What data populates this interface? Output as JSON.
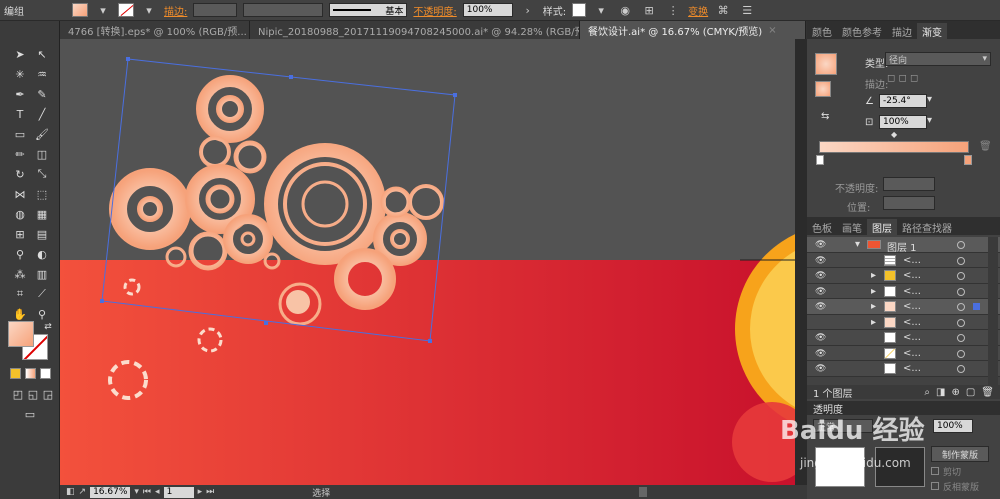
{
  "menu": {
    "label": "编组"
  },
  "control_bar": {
    "stroke_label": "描边:",
    "stroke_preset": "基本",
    "opacity_label": "不透明度:",
    "opacity_value": "100%",
    "style_label": "样式:",
    "transform_label": "变换",
    "fill_color": "#f9b295",
    "accent_color": "#f08c2a"
  },
  "tabs": [
    {
      "label": "4766 [转换].eps* @ 100% (RGB/预...",
      "close": "×"
    },
    {
      "label": "Nipic_20180988_20171119094708245000.ai* @ 94.28% (RGB/预...",
      "close": "×"
    },
    {
      "label": "餐饮设计.ai* @ 16.67% (CMYK/预览)",
      "close": "×"
    }
  ],
  "gradient_panel": {
    "tabs": [
      "颜色",
      "颜色参考",
      "描边",
      "渐变"
    ],
    "type_label": "类型:",
    "type_value": "径向",
    "stroke_label": "描边:",
    "angle_value": "-25.4°",
    "aspect_value": "100%",
    "opacity_label": "不透明度:",
    "position_label": "位置:",
    "stop_start": "#fbd7c4",
    "stop_end": "#f6a27a"
  },
  "layers_panel": {
    "tabs": [
      "色板",
      "画笔",
      "图层",
      "路径查找器"
    ],
    "layer_name": "图层 1",
    "sub_items": [
      "<...",
      "<...",
      "<...",
      "<...",
      "<...",
      "<...",
      "<...",
      "<..."
    ],
    "count_label": "1 个图层"
  },
  "transparency_panel": {
    "title": "透明度",
    "mode_label": "正常",
    "opacity_value": "100%",
    "make_mask": "制作蒙版",
    "clip_label": "剪切",
    "invert_label": "反相蒙版"
  },
  "status_bar": {
    "zoom": "16.67%",
    "page": "1",
    "tool": "选择"
  },
  "watermark": {
    "text": "Baidu 经验",
    "url": "jingyan.baidu.com"
  },
  "artboard": {
    "red_start": "#f3513c",
    "red_end": "#c8112c",
    "ring_color": "#f7b392"
  }
}
